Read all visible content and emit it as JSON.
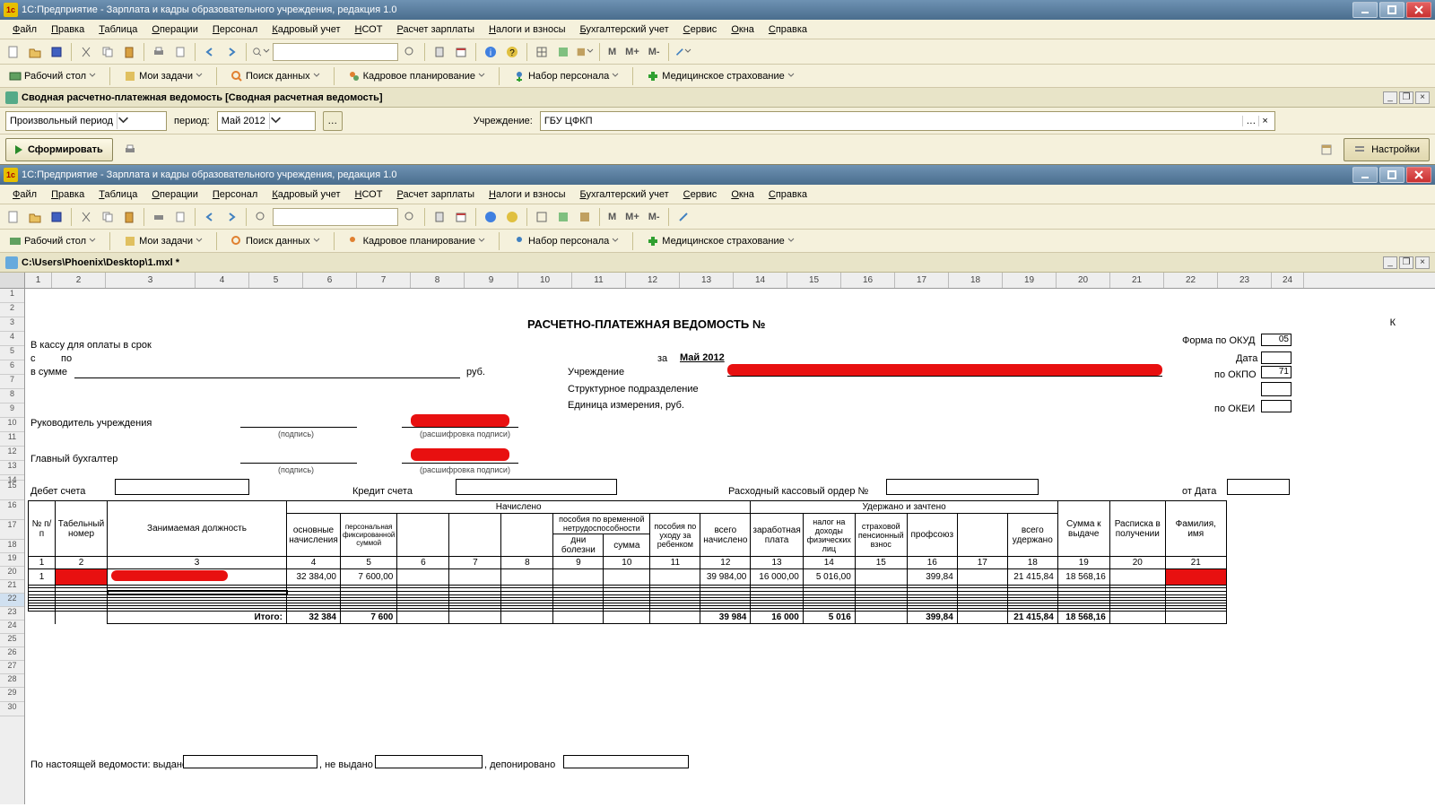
{
  "app_title": "1С:Предприятие - Зарплата и кадры образовательного учреждения, редакция 1.0",
  "menus": [
    "Файл",
    "Правка",
    "Таблица",
    "Операции",
    "Персонал",
    "Кадровый учет",
    "НСОТ",
    "Расчет зарплаты",
    "Налоги и взносы",
    "Бухгалтерский учет",
    "Сервис",
    "Окна",
    "Справка"
  ],
  "zoom_btns": {
    "m": "M",
    "mplus": "M+",
    "mminus": "M-"
  },
  "nav": {
    "desktop": "Рабочий стол",
    "tasks": "Мои задачи",
    "search": "Поиск данных",
    "kadr": "Кадровое планирование",
    "nabor": "Набор персонала",
    "med": "Медицинское страхование"
  },
  "doc_tab": "Сводная расчетно-платежная ведомость [Сводная расчетная ведомость]",
  "form": {
    "period_type": "Произвольный период",
    "period_lbl": "период:",
    "period_val": "Май 2012",
    "org_lbl": "Учреждение:",
    "org_val": "ГБУ ЦФКП",
    "btn_form": "Сформировать",
    "btn_settings": "Настройки"
  },
  "sheet_path": "C:\\Users\\Phoenix\\Desktop\\1.mxl *",
  "cols": [
    30,
    60,
    100,
    60,
    60,
    60,
    60,
    60,
    60,
    60,
    60,
    60,
    60,
    60,
    60,
    60,
    60,
    60,
    60,
    60,
    60,
    60,
    60,
    36
  ],
  "doc": {
    "title": "РАСЧЕТНО-ПЛАТЕЖНАЯ ВЕДОМОСТЬ №",
    "cash": "В кассу для оплаты в срок",
    "s": "с",
    "po": "по",
    "vsumme": "в сумме",
    "rub": "руб.",
    "za": "за",
    "period": "Май 2012",
    "org": "Учреждение",
    "dept": "Структурное подразделение",
    "unit": "Единица измерения, руб.",
    "ruk": "Руководитель учреждения",
    "buh": "Главный бухгалтер",
    "sign": "(подпись)",
    "decode": "(расшифровка подписи)",
    "debit": "Дебет счета",
    "kredit": "Кредит счета",
    "rko": "Расходный кассовый ордер №",
    "ot_data": "от  Дата",
    "form_okud": "Форма по ОКУД",
    "data_lbl": "Дата",
    "okpo": "по ОКПО",
    "okei": "по ОКЕИ",
    "okud_val": "05",
    "okpo_val": "71",
    "r_k": "К"
  },
  "headers": {
    "np": "№ п/п",
    "tab": "Табельный номер",
    "pos": "Занимаемая должность",
    "nach": "Начислено",
    "uder": "Удержано и зачтено",
    "osn": "основные начисления",
    "fix": "персональная фиксированной суммой",
    "posob": "пособия по временной нетрудоспособности",
    "days": "дни болезни",
    "sum": "сумма",
    "child": "пособия по уходу за ребенком",
    "vsego_n": "всего начислено",
    "zp": "заработная плата",
    "ndfl": "налог на доходы физических лиц",
    "pens": "страховой пенсионный взнос",
    "prof": "профсоюз",
    "vsego_u": "всего удержано",
    "kvyd": "Сумма к выдаче",
    "rasp": "Расписка в получении",
    "fio": "Фамилия, имя"
  },
  "colnums": [
    "1",
    "2",
    "3",
    "4",
    "5",
    "6",
    "7",
    "8",
    "9",
    "10",
    "11",
    "12",
    "13",
    "14",
    "15",
    "16",
    "17",
    "18",
    "19",
    "20",
    "21"
  ],
  "row1": {
    "n": "1",
    "c4": "32 384,00",
    "c5": "7 600,00",
    "c12": "39 984,00",
    "c13": "16 000,00",
    "c14": "5 016,00",
    "c16": "399,84",
    "c18": "21 415,84",
    "c19": "18 568,16"
  },
  "totals": {
    "lbl": "Итого:",
    "c4": "32 384",
    "c5": "7 600",
    "c12": "39 984",
    "c13": "16 000",
    "c14": "5 016",
    "c16": "399,84",
    "c18": "21 415,84",
    "c19": "18 568,16"
  },
  "footer": {
    "text": "По настоящей ведомости: выдано",
    "nev": ", не выдано",
    "dep": ", депонировано"
  }
}
